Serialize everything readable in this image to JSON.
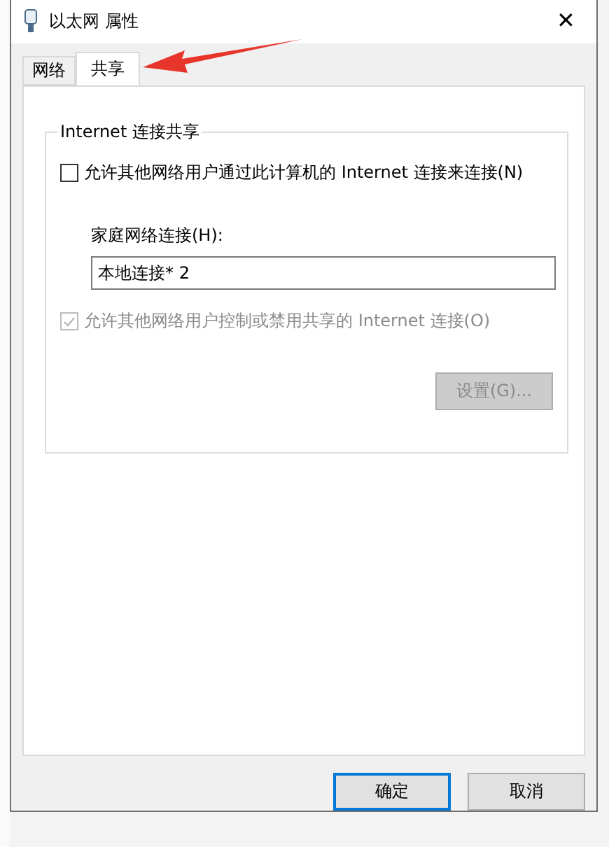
{
  "window": {
    "title": "以太网 属性",
    "close": "✕"
  },
  "tabs": [
    {
      "label": "网络",
      "selected": false
    },
    {
      "label": "共享",
      "selected": true
    }
  ],
  "group": {
    "title": "Internet 连接共享",
    "allow_sharing": {
      "label": "允许其他网络用户通过此计算机的 Internet 连接来连接(N)",
      "checked": false,
      "disabled": false
    },
    "home_connection": {
      "label": "家庭网络连接(H):",
      "value": "本地连接* 2"
    },
    "allow_control": {
      "label": "允许其他网络用户控制或禁用共享的 Internet 连接(O)",
      "checked": true,
      "disabled": true
    },
    "settings_button": {
      "label": "设置(G)...",
      "disabled": true
    }
  },
  "buttons": [
    {
      "label": "确定",
      "default": true
    },
    {
      "label": "取消",
      "default": false
    }
  ]
}
